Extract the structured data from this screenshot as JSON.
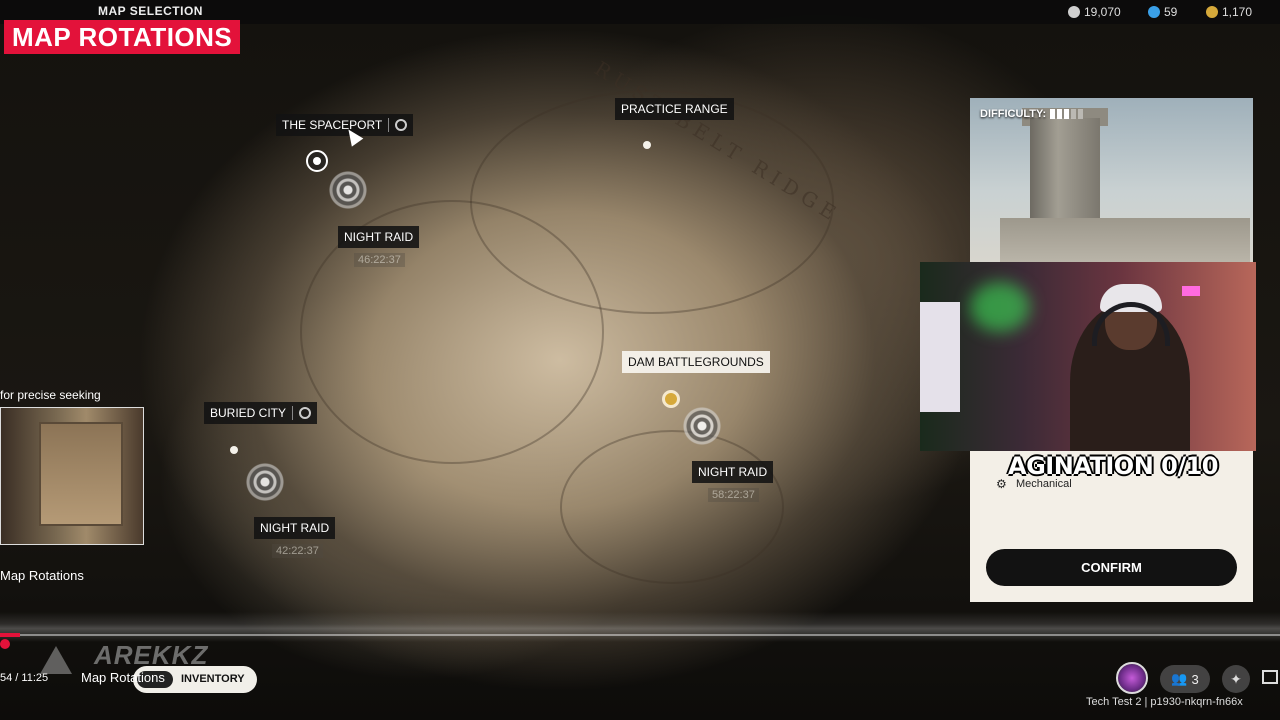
{
  "header": {
    "section_title": "MAP SELECTION",
    "stats": [
      {
        "value": "19,070",
        "icon": "currency-icon",
        "color": "#cfcfcf"
      },
      {
        "value": "59",
        "icon": "token-icon",
        "color": "#3aa0e8"
      },
      {
        "value": "1,170",
        "icon": "gold-icon",
        "color": "#d6a93a"
      }
    ]
  },
  "banner": {
    "text": "MAP ROTATIONS",
    "color": "#e3123a"
  },
  "map": {
    "locations": [
      {
        "name": "THE SPACEPORT"
      },
      {
        "name": "PRACTICE RANGE"
      },
      {
        "name": "DAM BATTLEGROUNDS"
      },
      {
        "name": "BURIED CITY"
      }
    ],
    "night_raids": [
      {
        "label": "NIGHT RAID",
        "timer": "46:22:37"
      },
      {
        "label": "NIGHT RAID",
        "timer": "58:22:37"
      },
      {
        "label": "NIGHT RAID",
        "timer": "42:22:37"
      }
    ],
    "terrain_text": "RUST BELT RIDGE"
  },
  "panel": {
    "difficulty_label": "DIFFICULTY:",
    "difficulty_level": 3,
    "difficulty_max": 5,
    "modifier": "Mechanical",
    "confirm_label": "CONFIRM"
  },
  "overlay": {
    "text": "AGINATION 0/10"
  },
  "player": {
    "seek_hint": "for precise seeking",
    "preview_title": "Map Rotations",
    "time": "54 / 11:25",
    "chapter": "Map Rotations",
    "channel_logo": "AREKKZ"
  },
  "bottom": {
    "inventory_label": "INVENTORY",
    "party_count": "3",
    "build_info": "Tech Test 2 | p1930-nkqrn-fn66x"
  }
}
